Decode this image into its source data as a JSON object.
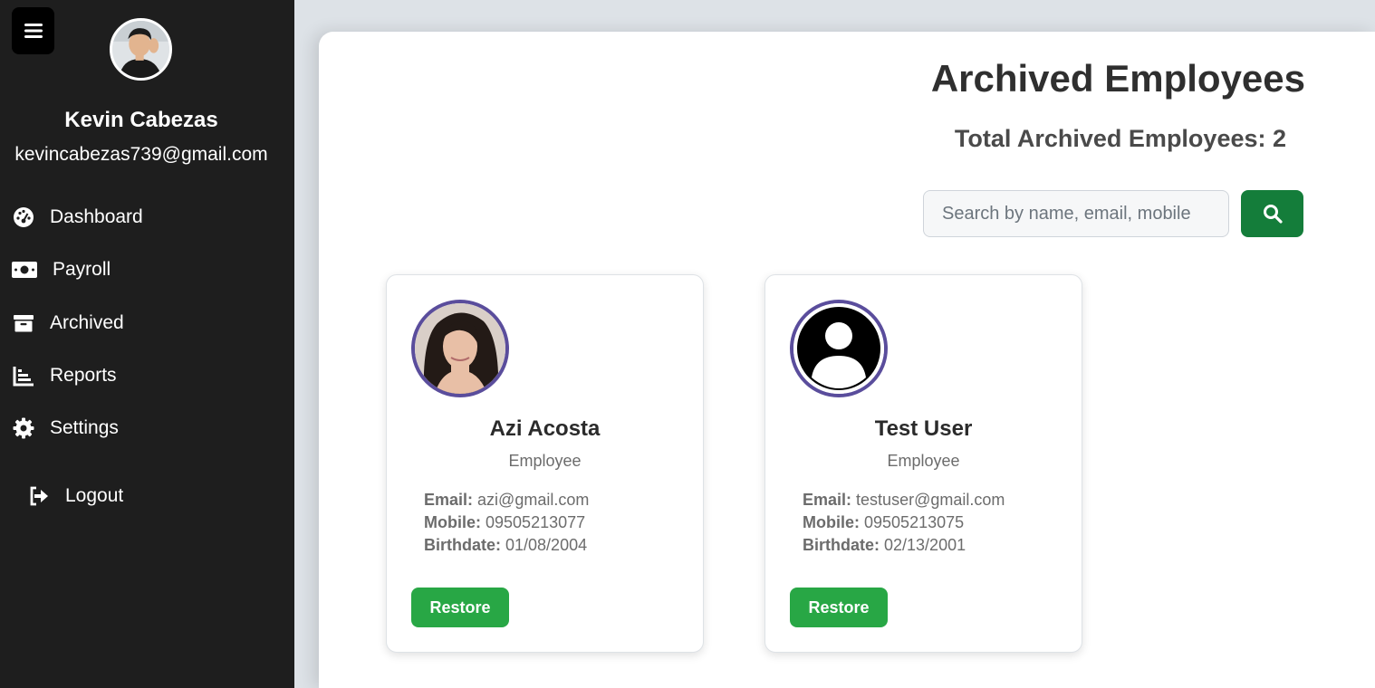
{
  "sidebar": {
    "user": {
      "name": "Kevin Cabezas",
      "email": "kevincabezas739@gmail.com"
    },
    "nav": [
      {
        "label": "Dashboard",
        "icon": "dashboard-icon"
      },
      {
        "label": "Payroll",
        "icon": "money-icon"
      },
      {
        "label": "Archived",
        "icon": "archive-icon"
      },
      {
        "label": "Reports",
        "icon": "chart-icon"
      },
      {
        "label": "Settings",
        "icon": "gear-icon"
      }
    ],
    "logout_label": "Logout"
  },
  "main": {
    "title": "Archived Employees",
    "total_label": "Total Archived Employees: 2",
    "search": {
      "placeholder": "Search by name, email, mobile",
      "value": ""
    },
    "cards": [
      {
        "name": "Azi Acosta",
        "role": "Employee",
        "email_label": "Email:",
        "email": "azi@gmail.com",
        "mobile_label": "Mobile:",
        "mobile": "09505213077",
        "birthdate_label": "Birthdate:",
        "birthdate": "01/08/2004",
        "restore_label": "Restore"
      },
      {
        "name": "Test User",
        "role": "Employee",
        "email_label": "Email:",
        "email": "testuser@gmail.com",
        "mobile_label": "Mobile:",
        "mobile": "09505213075",
        "birthdate_label": "Birthdate:",
        "birthdate": "02/13/2001",
        "restore_label": "Restore"
      }
    ]
  },
  "colors": {
    "sidebar_bg": "#1e1e1e",
    "search_button": "#147d3a",
    "restore_button": "#28a745",
    "avatar_border": "#5a4d9c"
  }
}
